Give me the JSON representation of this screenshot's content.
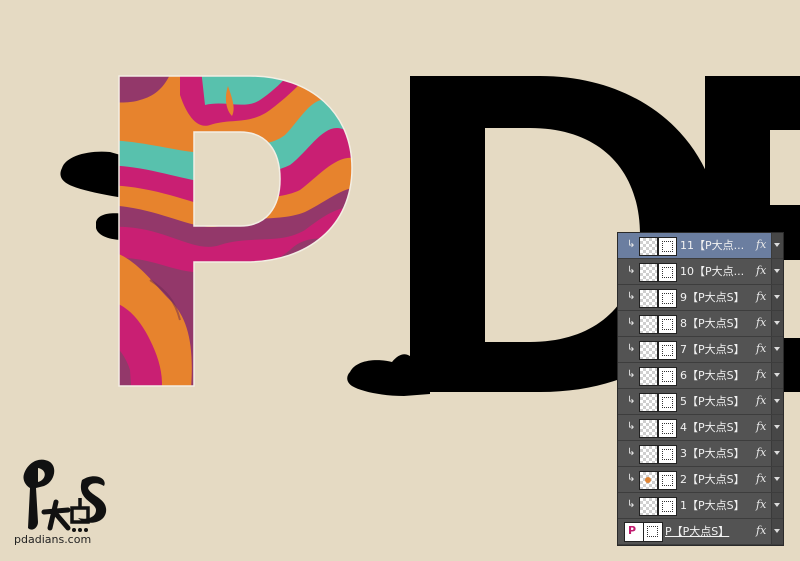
{
  "canvas": {
    "background": "#e5dac3",
    "colors": {
      "teal": "#58c1ad",
      "orange": "#e7832d",
      "magenta": "#c91f73",
      "plum": "#93386a",
      "black": "#000000"
    },
    "artwork_text": "PDE"
  },
  "layers_panel": {
    "layers": [
      {
        "label": "11【P大点...",
        "fx": "fx",
        "selected": true
      },
      {
        "label": "10【P大点...",
        "fx": "fx"
      },
      {
        "label": "9【P大点S】",
        "fx": "fx"
      },
      {
        "label": "8【P大点S】",
        "fx": "fx"
      },
      {
        "label": "7【P大点S】",
        "fx": "fx"
      },
      {
        "label": "6【P大点S】",
        "fx": "fx"
      },
      {
        "label": "5【P大点S】",
        "fx": "fx"
      },
      {
        "label": "4【P大点S】",
        "fx": "fx"
      },
      {
        "label": "3【P大点S】",
        "fx": "fx"
      },
      {
        "label": "2【P大点S】",
        "fx": "fx"
      },
      {
        "label": "1【P大点S】",
        "fx": "fx"
      }
    ],
    "base_layer": {
      "label": "P【P大点S】",
      "fx": "fx",
      "thumb_letter": "P"
    }
  },
  "watermark": {
    "logo_text": "PS大点",
    "site": "pdadians.com"
  }
}
